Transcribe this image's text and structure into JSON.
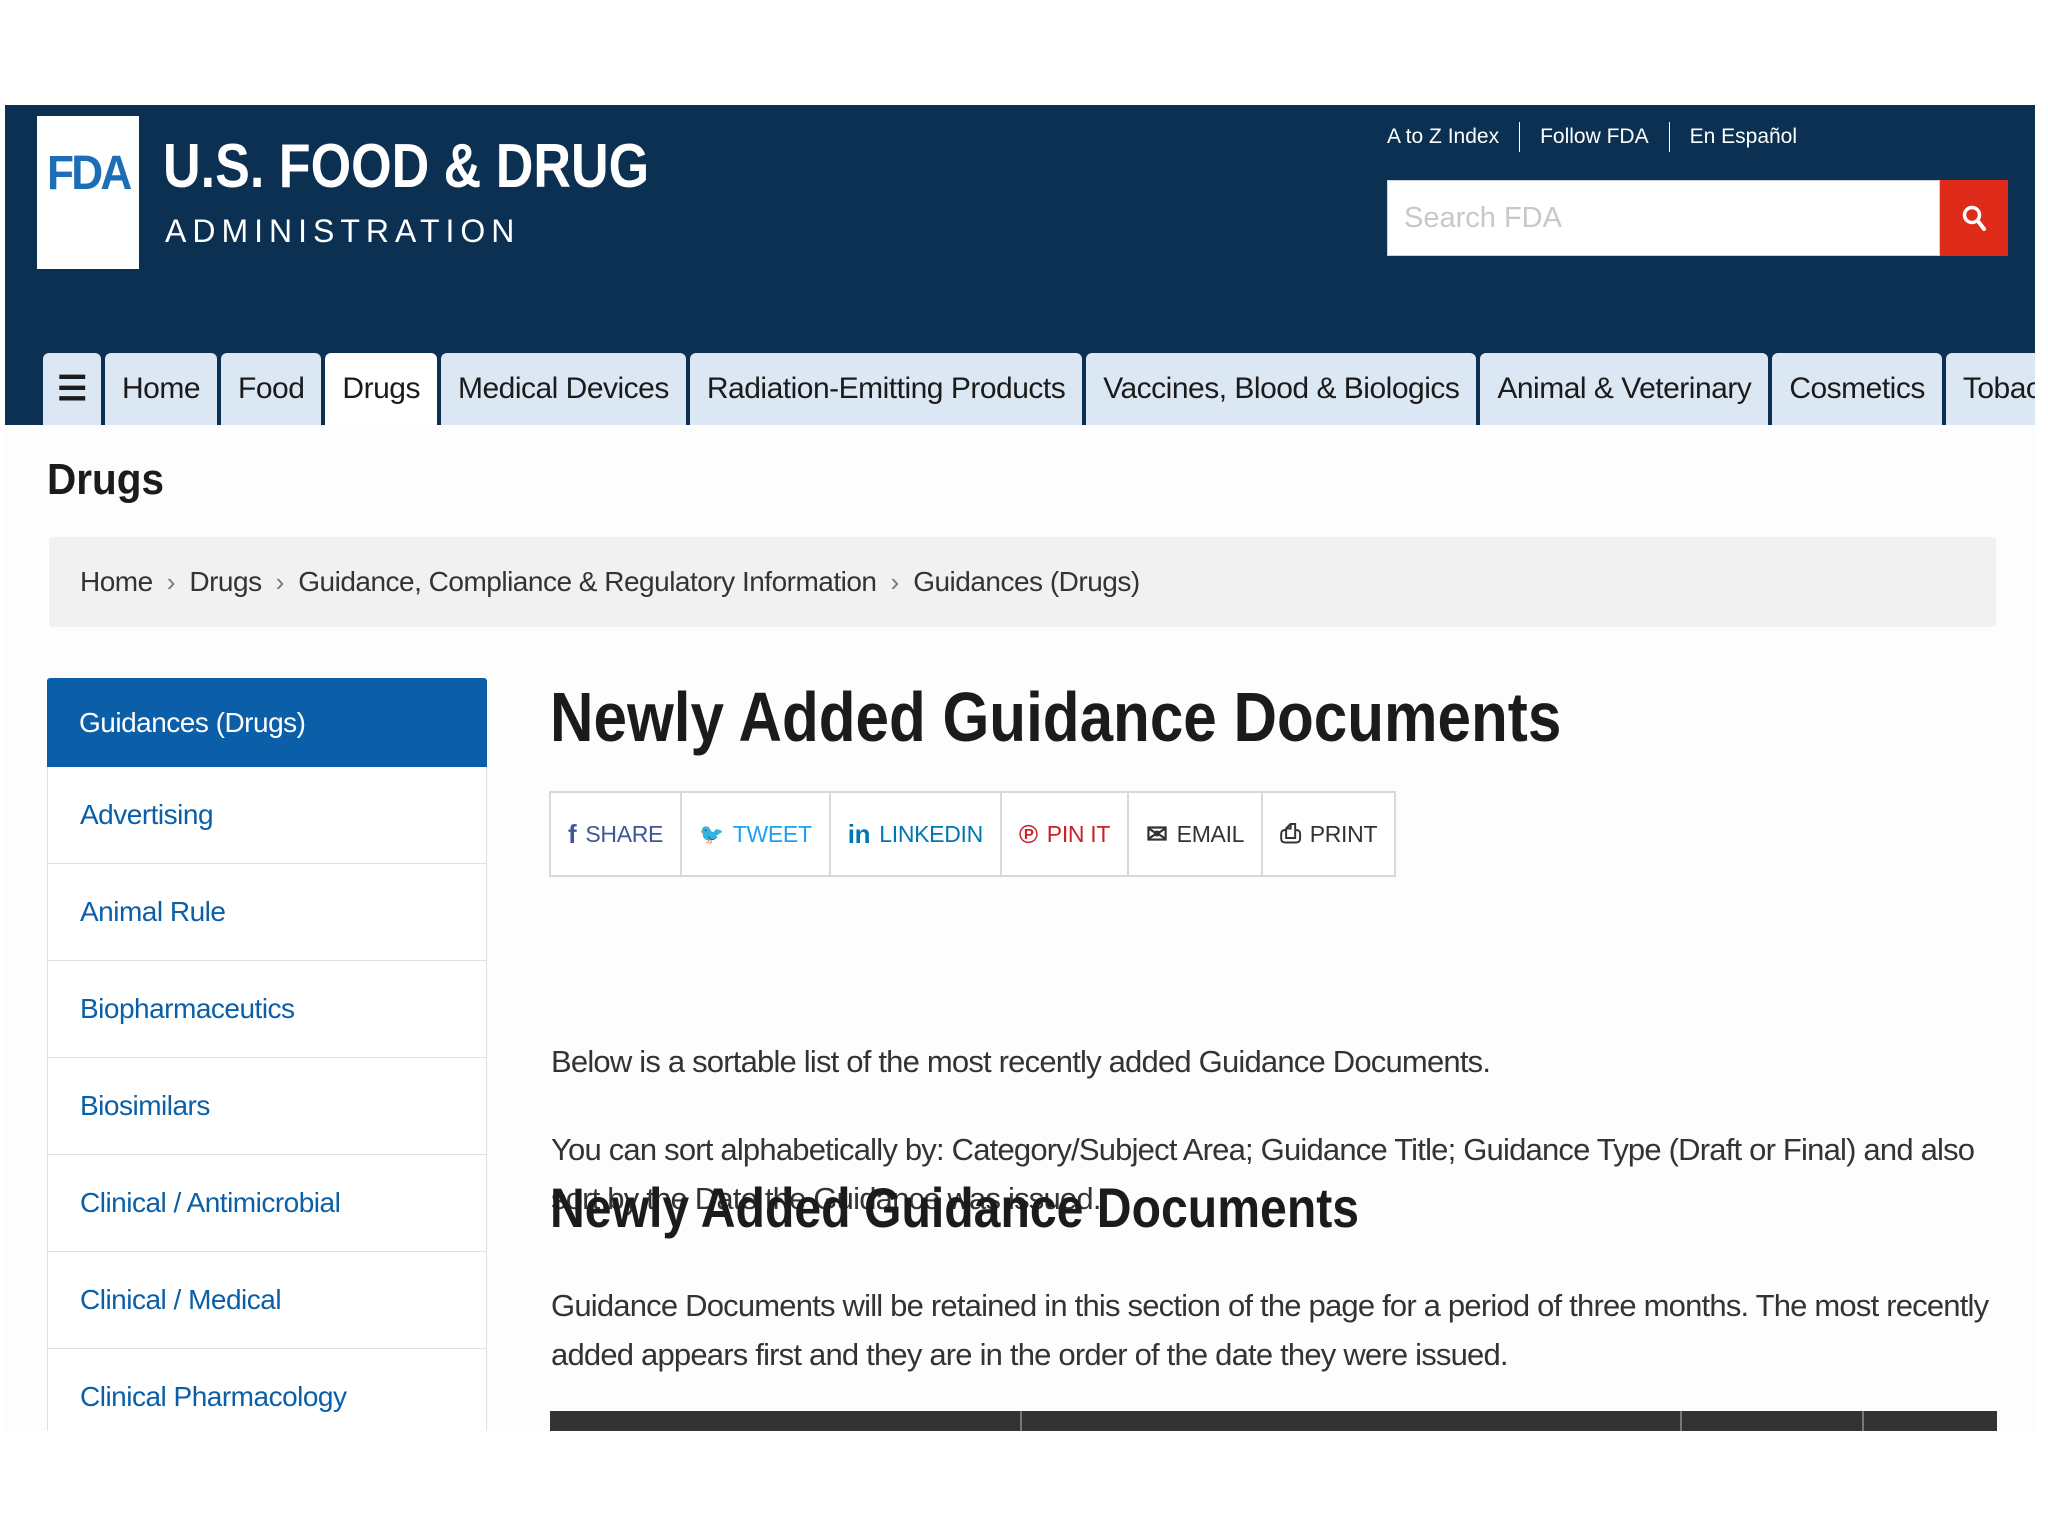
{
  "header": {
    "logo_mark": "FDA",
    "logo_title": "U.S. FOOD & DRUG",
    "logo_subtitle": "ADMINISTRATION",
    "utility_links": [
      "A to Z Index",
      "Follow FDA",
      "En Español"
    ],
    "search": {
      "placeholder": "Search FDA",
      "value": "",
      "button_icon": "search-icon"
    },
    "colors": {
      "background": "#0b3052",
      "search_button": "#df2b1a"
    }
  },
  "nav": {
    "menu_icon": "☰",
    "tabs": [
      {
        "label": "Home",
        "active": false
      },
      {
        "label": "Food",
        "active": false
      },
      {
        "label": "Drugs",
        "active": true
      },
      {
        "label": "Medical Devices",
        "active": false
      },
      {
        "label": "Radiation-Emitting Products",
        "active": false
      },
      {
        "label": "Vaccines, Blood & Biologics",
        "active": false
      },
      {
        "label": "Animal & Veterinary",
        "active": false
      },
      {
        "label": "Cosmetics",
        "active": false
      },
      {
        "label": "Tobacco Products",
        "active": false
      }
    ]
  },
  "page": {
    "section_title": "Drugs",
    "breadcrumb": [
      "Home",
      "Drugs",
      "Guidance, Compliance & Regulatory Information",
      "Guidances (Drugs)"
    ],
    "breadcrumb_separator": "›"
  },
  "sidebar": {
    "heading": "Guidances (Drugs)",
    "items": [
      "Advertising",
      "Animal Rule",
      "Biopharmaceutics",
      "Biosimilars",
      "Clinical / Antimicrobial",
      "Clinical / Medical",
      "Clinical Pharmacology"
    ],
    "colors": {
      "heading_bg": "#0a5fa8",
      "link": "#0a5fa8"
    }
  },
  "main": {
    "title": "Newly Added Guidance Documents",
    "share": [
      {
        "label": "SHARE",
        "icon": "facebook-icon",
        "glyph": "f",
        "color": "#3b5998"
      },
      {
        "label": "TWEET",
        "icon": "twitter-icon",
        "glyph": "🐦",
        "color": "#1da1f2"
      },
      {
        "label": "LINKEDIN",
        "icon": "linkedin-icon",
        "glyph": "in",
        "color": "#0077b5"
      },
      {
        "label": "PIN IT",
        "icon": "pinterest-icon",
        "glyph": "℗",
        "color": "#cb2027"
      },
      {
        "label": "EMAIL",
        "icon": "email-icon",
        "glyph": "✉",
        "color": "#333333"
      },
      {
        "label": "PRINT",
        "icon": "print-icon",
        "glyph": "⎙",
        "color": "#333333"
      }
    ],
    "intro_1": "Below is a sortable list of the most recently added Guidance Documents.",
    "intro_2": "You can sort alphabetically by: Category/Subject Area; Guidance Title; Guidance Type (Draft or Final) and also sort by the Date the Guidance was issued.",
    "subtitle": "Newly Added Guidance Documents",
    "retention_text": "Guidance Documents will be retained in this section of the page for a period of three months. The most recently added appears first and they are in the order of the date they were issued."
  }
}
